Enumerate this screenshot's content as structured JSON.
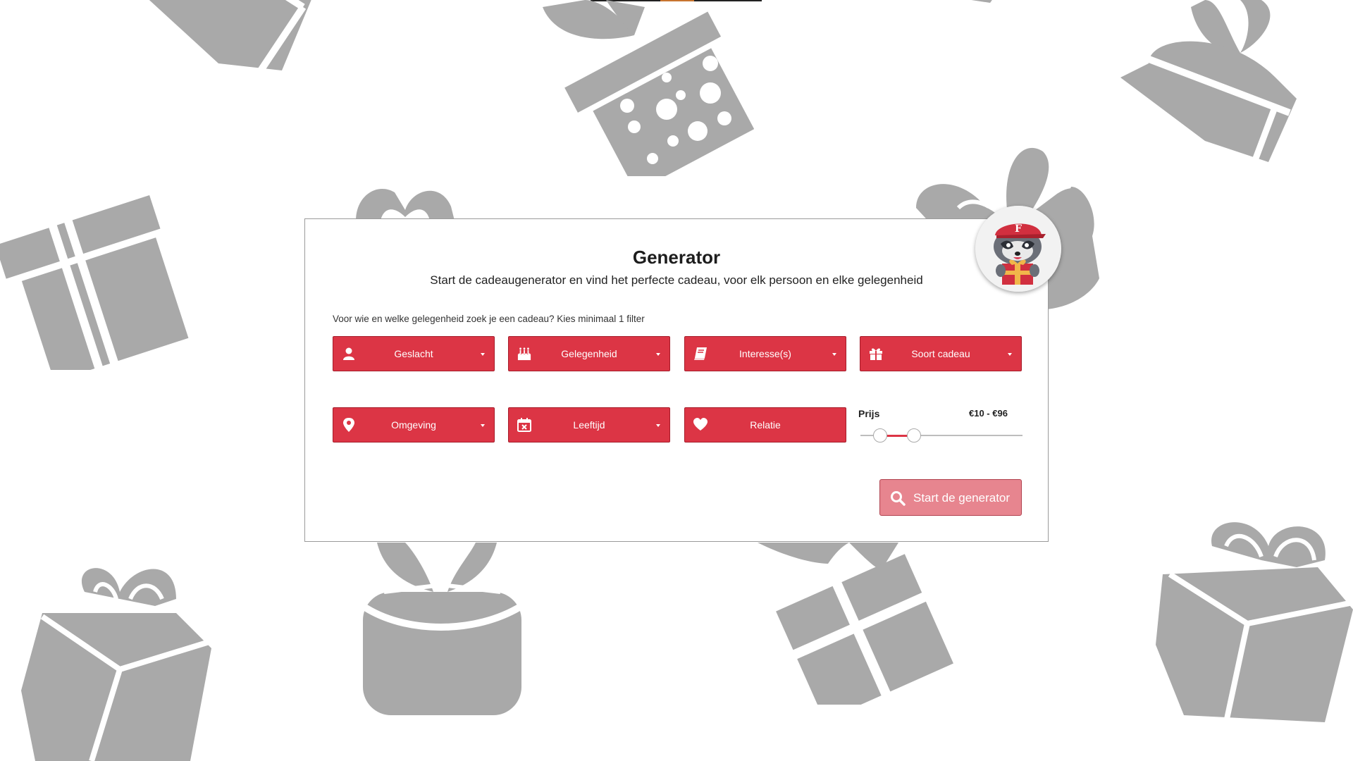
{
  "colors": {
    "accent": "#dc3545",
    "accent_border": "#a61c2a",
    "button_disabled": "#e7858f",
    "background_gifts": "#a9a9a9"
  },
  "generator": {
    "title": "Generator",
    "subtitle": "Start de cadeaugenerator en vind het perfecte cadeau, voor elk persoon en elke gelegenheid",
    "hint": "Voor wie en welke gelegenheid zoek je een cadeau? Kies minimaal 1 filter"
  },
  "filters": [
    {
      "label": "Geslacht",
      "icon": "person-icon"
    },
    {
      "label": "Gelegenheid",
      "icon": "birthday-cake-icon"
    },
    {
      "label": "Interesse(s)",
      "icon": "book-icon"
    },
    {
      "label": "Soort cadeau",
      "icon": "gift-icon"
    },
    {
      "label": "Omgeving",
      "icon": "map-pin-icon"
    },
    {
      "label": "Leeftijd",
      "icon": "calendar-icon"
    },
    {
      "label": "Relatie",
      "icon": "heart-icon"
    }
  ],
  "price": {
    "label": "Prijs",
    "range_text": "€10 - €96",
    "min_fraction": 0.12,
    "max_fraction": 0.33
  },
  "start_button": {
    "label": "Start de generator",
    "icon": "search-icon"
  },
  "mascot": {
    "icon": "raccoon-mascot-icon"
  }
}
